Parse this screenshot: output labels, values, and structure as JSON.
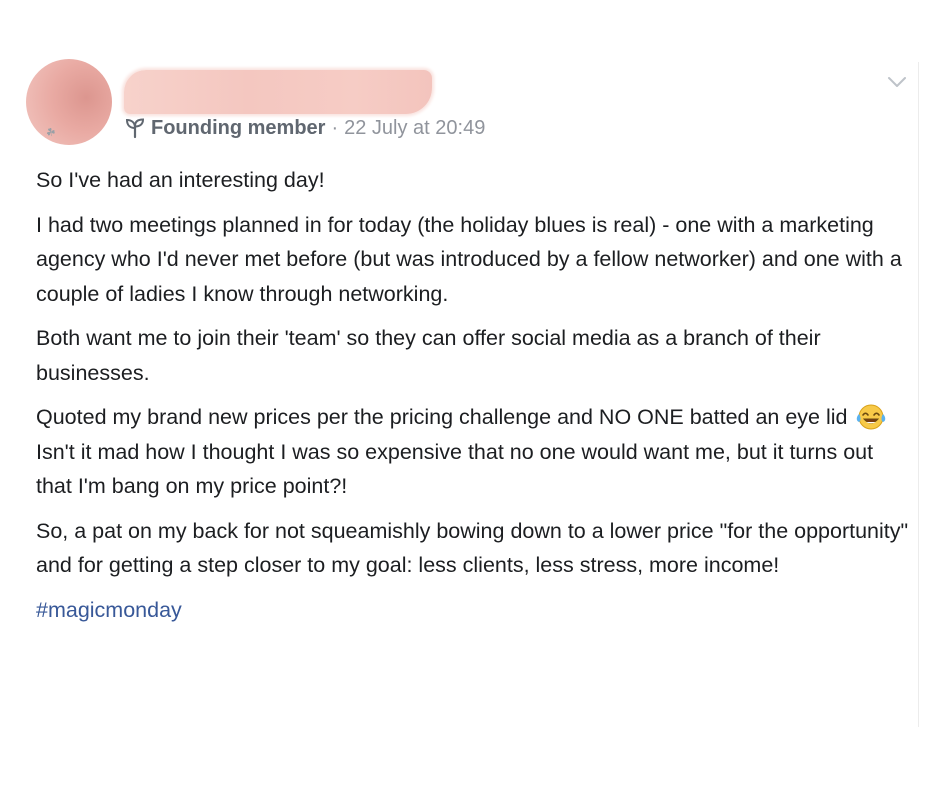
{
  "post": {
    "author_meta": {
      "badge_label": "Founding member",
      "separator": "·",
      "timestamp": "22 July at 20:49"
    },
    "paragraphs": [
      "So I've had an interesting day!",
      "I had two meetings planned in for today (the holiday blues is real) - one with a marketing agency who I'd never met before (but was introduced by a fellow networker) and one with a couple of ladies I know through networking.",
      "Both want me to join their 'team' so they can offer social media as a branch of their businesses.",
      "So, a pat on my back for not squeamishly bowing down to a lower price \"for the opportunity\" and for getting a step closer to my goal: less clients, less stress, more income!"
    ],
    "pricing_paragraph": {
      "before_emoji": "Quoted my brand new prices per the pricing challenge and NO ONE batted an eye lid",
      "after_emoji": "Isn't it mad how I thought I was so expensive that no one would want me, but it turns out that I'm bang on my price point?!"
    },
    "hashtag": "#magicmonday"
  },
  "icons": {
    "avatar_badge": "☘",
    "menu": "chevron-down-icon",
    "badge": "sprout-icon",
    "emoji": "crying-laughing-emoji-icon"
  },
  "colors": {
    "text": "#1c1e21",
    "meta": "#90949c",
    "badge": "#606770",
    "link": "#385898"
  }
}
